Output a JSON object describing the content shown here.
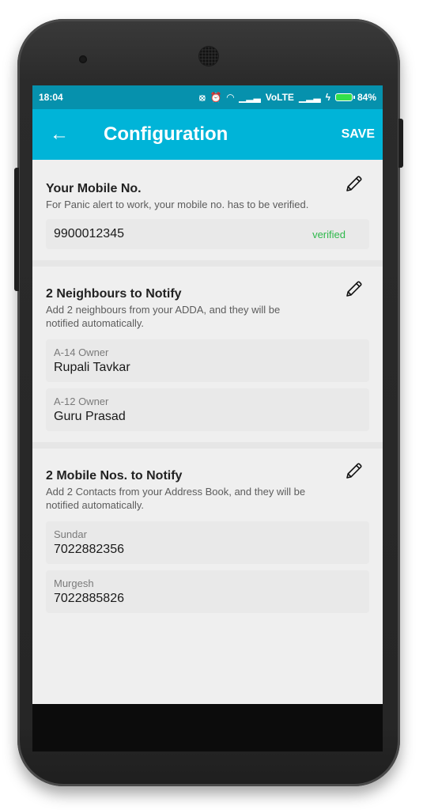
{
  "status_bar": {
    "time": "18:04",
    "network": "VoLTE",
    "battery": "84%"
  },
  "app_bar": {
    "title": "Configuration",
    "save_label": "SAVE"
  },
  "mobile_section": {
    "title": "Your Mobile No.",
    "description": "For Panic alert to work, your mobile no. has to be verified.",
    "number": "9900012345",
    "status": "verified"
  },
  "neighbours_section": {
    "title": "2 Neighbours to Notify",
    "description": "Add 2 neighbours from your ADDA, and they will be notified automatically.",
    "items": [
      {
        "unit": "A-14 Owner",
        "name": "Rupali Tavkar"
      },
      {
        "unit": "A-12 Owner",
        "name": "Guru  Prasad"
      }
    ]
  },
  "mobiles_section": {
    "title": "2 Mobile Nos. to Notify",
    "description": "Add 2 Contacts from your Address Book, and they will be notified automatically.",
    "items": [
      {
        "name": "Sundar",
        "number": "7022882356"
      },
      {
        "name": "Murgesh",
        "number": "7022885826"
      }
    ]
  },
  "colors": {
    "status_bar": "#0691ad",
    "app_bar": "#00b4d8",
    "verified": "#2eb84b"
  }
}
